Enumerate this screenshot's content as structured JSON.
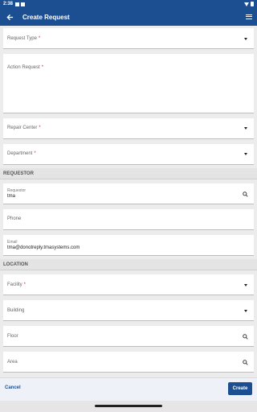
{
  "status_bar": {
    "time": "2:38"
  },
  "app_bar": {
    "title": "Create Request"
  },
  "form": {
    "request_type": {
      "label": "Request Type",
      "required": "*"
    },
    "action_request": {
      "label": "Action Request",
      "required": "*"
    },
    "repair_center": {
      "label": "Repair Center",
      "required": "*"
    },
    "department": {
      "label": "Department",
      "required": "*"
    }
  },
  "requestor_section": {
    "title": "REQUESTOR",
    "requestor": {
      "label": "Requestor",
      "value": "tma"
    },
    "phone": {
      "label": "Phone"
    },
    "email": {
      "label": "Email",
      "value": "tma@donotreply.tmasystems.com"
    }
  },
  "location_section": {
    "title": "LOCATION",
    "facility": {
      "label": "Facility",
      "required": "*"
    },
    "building": {
      "label": "Building"
    },
    "floor": {
      "label": "Floor"
    },
    "area": {
      "label": "Area"
    }
  },
  "footer": {
    "cancel_label": "Cancel",
    "create_label": "Create"
  },
  "colors": {
    "primary": "#1c4f92",
    "required": "#d32f2f"
  }
}
